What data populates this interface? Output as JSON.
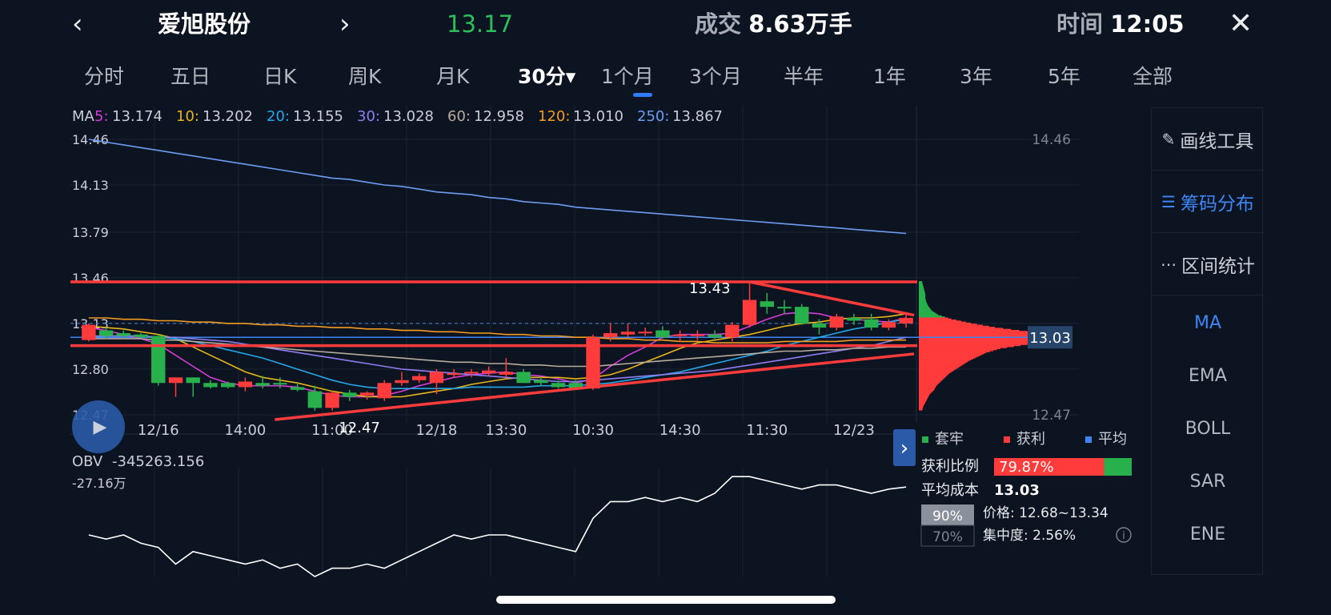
{
  "header": {
    "prev_icon": "chevron-left-icon",
    "next_icon": "chevron-right-icon",
    "close_icon": "close-icon",
    "prev_glyph": "‹",
    "next_glyph": "›",
    "close_glyph": "✕",
    "stock_name": "爱旭股份",
    "price": "13.17",
    "volume_label": "成交",
    "volume_value": "8.63万手",
    "time_label": "时间",
    "time_value": "12:05"
  },
  "tabs": [
    "分时",
    "五日",
    "日K",
    "周K",
    "月K",
    "30分▾",
    "1个月",
    "3个月",
    "半年",
    "1年",
    "3年",
    "5年",
    "全部"
  ],
  "active_tab": "30分",
  "colors": {
    "up": "#ff3b3b",
    "down": "#27b04b",
    "ma5": "#d63cd8",
    "ma10": "#e5b51a",
    "ma20": "#22a8e8",
    "ma30": "#8f7cf0",
    "ma60": "#b8aa9c",
    "ma120": "#f39a20",
    "ma250": "#6c9cf2",
    "accent": "#3e86f5",
    "trendline": "#ff3b3b",
    "obv": "#ffffff"
  },
  "ma_legend": {
    "label": "MA",
    "items": [
      {
        "key": "5:",
        "value": "13.174",
        "color": "#d63cd8"
      },
      {
        "key": "10:",
        "value": "13.202",
        "color": "#e5b51a"
      },
      {
        "key": "20:",
        "value": "13.155",
        "color": "#22a8e8"
      },
      {
        "key": "30:",
        "value": "13.028",
        "color": "#8f7cf0"
      },
      {
        "key": "60:",
        "value": "12.958",
        "color": "#b8aa9c"
      },
      {
        "key": "120:",
        "value": "13.010",
        "color": "#f39a20"
      },
      {
        "key": "250:",
        "value": "13.867",
        "color": "#6c9cf2"
      }
    ]
  },
  "chart_data": {
    "type": "candlestick",
    "ylim": [
      12.47,
      14.46
    ],
    "y_ticks_left": [
      "14.46",
      "14.13",
      "13.79",
      "13.46",
      "13.13",
      "12.80",
      "12.47"
    ],
    "y_ticks_right": [
      "14.46",
      "12.47"
    ],
    "x_tick_labels": [
      "12/16",
      "14:00",
      "11:00",
      "12/18",
      "13:30",
      "10:30",
      "14:30",
      "11:30",
      "12/23"
    ],
    "x_tick_index": [
      4,
      9,
      14,
      20,
      24,
      29,
      34,
      39,
      44
    ],
    "candles": [
      {
        "o": 13.01,
        "h": 13.13,
        "l": 13.0,
        "c": 13.12
      },
      {
        "o": 13.08,
        "h": 13.1,
        "l": 13.02,
        "c": 13.04
      },
      {
        "o": 13.06,
        "h": 13.08,
        "l": 13.02,
        "c": 13.04
      },
      {
        "o": 13.05,
        "h": 13.06,
        "l": 13.03,
        "c": 13.03
      },
      {
        "o": 13.04,
        "h": 13.05,
        "l": 12.68,
        "c": 12.7
      },
      {
        "o": 12.7,
        "h": 12.74,
        "l": 12.6,
        "c": 12.74
      },
      {
        "o": 12.74,
        "h": 12.74,
        "l": 12.6,
        "c": 12.7
      },
      {
        "o": 12.7,
        "h": 12.72,
        "l": 12.66,
        "c": 12.67
      },
      {
        "o": 12.7,
        "h": 12.71,
        "l": 12.66,
        "c": 12.67
      },
      {
        "o": 12.67,
        "h": 12.74,
        "l": 12.64,
        "c": 12.71
      },
      {
        "o": 12.7,
        "h": 12.75,
        "l": 12.66,
        "c": 12.68
      },
      {
        "o": 12.7,
        "h": 12.74,
        "l": 12.66,
        "c": 12.69
      },
      {
        "o": 12.67,
        "h": 12.7,
        "l": 12.64,
        "c": 12.65
      },
      {
        "o": 12.64,
        "h": 12.68,
        "l": 12.5,
        "c": 12.52
      },
      {
        "o": 12.52,
        "h": 12.64,
        "l": 12.5,
        "c": 12.63
      },
      {
        "o": 12.63,
        "h": 12.65,
        "l": 12.57,
        "c": 12.6
      },
      {
        "o": 12.61,
        "h": 12.64,
        "l": 12.58,
        "c": 12.63
      },
      {
        "o": 12.59,
        "h": 12.72,
        "l": 12.57,
        "c": 12.7
      },
      {
        "o": 12.7,
        "h": 12.78,
        "l": 12.68,
        "c": 12.72
      },
      {
        "o": 12.72,
        "h": 12.77,
        "l": 12.7,
        "c": 12.75
      },
      {
        "o": 12.7,
        "h": 12.8,
        "l": 12.62,
        "c": 12.78
      },
      {
        "o": 12.76,
        "h": 12.8,
        "l": 12.74,
        "c": 12.77
      },
      {
        "o": 12.77,
        "h": 12.8,
        "l": 12.74,
        "c": 12.78
      },
      {
        "o": 12.77,
        "h": 12.82,
        "l": 12.75,
        "c": 12.79
      },
      {
        "o": 12.76,
        "h": 12.88,
        "l": 12.74,
        "c": 12.78
      },
      {
        "o": 12.78,
        "h": 12.8,
        "l": 12.7,
        "c": 12.7
      },
      {
        "o": 12.72,
        "h": 12.74,
        "l": 12.68,
        "c": 12.7
      },
      {
        "o": 12.7,
        "h": 12.72,
        "l": 12.66,
        "c": 12.67
      },
      {
        "o": 12.7,
        "h": 12.72,
        "l": 12.65,
        "c": 12.66
      },
      {
        "o": 12.66,
        "h": 13.05,
        "l": 12.65,
        "c": 13.03
      },
      {
        "o": 13.03,
        "h": 13.13,
        "l": 13.0,
        "c": 13.06
      },
      {
        "o": 13.05,
        "h": 13.13,
        "l": 13.03,
        "c": 13.07
      },
      {
        "o": 13.06,
        "h": 13.1,
        "l": 13.04,
        "c": 13.07
      },
      {
        "o": 13.08,
        "h": 13.11,
        "l": 13.02,
        "c": 13.03
      },
      {
        "o": 13.04,
        "h": 13.08,
        "l": 13.0,
        "c": 13.05
      },
      {
        "o": 13.04,
        "h": 13.08,
        "l": 13.01,
        "c": 13.05
      },
      {
        "o": 13.05,
        "h": 13.08,
        "l": 13.01,
        "c": 13.03
      },
      {
        "o": 13.03,
        "h": 13.14,
        "l": 13.0,
        "c": 13.12
      },
      {
        "o": 13.12,
        "h": 13.43,
        "l": 13.1,
        "c": 13.3
      },
      {
        "o": 13.29,
        "h": 13.35,
        "l": 13.2,
        "c": 13.25
      },
      {
        "o": 13.25,
        "h": 13.3,
        "l": 13.2,
        "c": 13.24
      },
      {
        "o": 13.25,
        "h": 13.27,
        "l": 13.12,
        "c": 13.13
      },
      {
        "o": 13.13,
        "h": 13.16,
        "l": 13.05,
        "c": 13.1
      },
      {
        "o": 13.1,
        "h": 13.2,
        "l": 13.08,
        "c": 13.18
      },
      {
        "o": 13.17,
        "h": 13.2,
        "l": 13.12,
        "c": 13.15
      },
      {
        "o": 13.16,
        "h": 13.2,
        "l": 13.08,
        "c": 13.1
      },
      {
        "o": 13.1,
        "h": 13.16,
        "l": 13.08,
        "c": 13.14
      },
      {
        "o": 13.13,
        "h": 13.2,
        "l": 13.1,
        "c": 13.17
      }
    ],
    "ma_series": {
      "ma5": [
        13.1,
        13.08,
        13.05,
        13.02,
        12.98,
        12.9,
        12.82,
        12.74,
        12.7,
        12.68,
        12.68,
        12.68,
        12.67,
        12.64,
        12.61,
        12.6,
        12.6,
        12.61,
        12.64,
        12.68,
        12.71,
        12.74,
        12.76,
        12.77,
        12.78,
        12.76,
        12.75,
        12.73,
        12.7,
        12.73,
        12.82,
        12.9,
        12.96,
        13.03,
        13.05,
        13.05,
        13.05,
        13.06,
        13.11,
        13.16,
        13.2,
        13.21,
        13.2,
        13.17,
        13.16,
        13.15,
        13.14,
        13.17
      ],
      "ma10": [
        13.11,
        13.1,
        13.09,
        13.07,
        13.05,
        13.02,
        12.96,
        12.9,
        12.84,
        12.78,
        12.74,
        12.72,
        12.7,
        12.67,
        12.64,
        12.62,
        12.6,
        12.6,
        12.6,
        12.62,
        12.64,
        12.66,
        12.69,
        12.71,
        12.73,
        12.74,
        12.74,
        12.74,
        12.73,
        12.74,
        12.76,
        12.8,
        12.85,
        12.9,
        12.95,
        12.99,
        13.01,
        13.03,
        13.05,
        13.08,
        13.11,
        13.13,
        13.14,
        13.16,
        13.17,
        13.17,
        13.18,
        13.2
      ],
      "ma20": [
        13.03,
        13.04,
        13.04,
        13.04,
        13.03,
        13.02,
        13.0,
        12.97,
        12.94,
        12.91,
        12.88,
        12.84,
        12.8,
        12.76,
        12.72,
        12.69,
        12.67,
        12.66,
        12.66,
        12.66,
        12.66,
        12.66,
        12.67,
        12.67,
        12.67,
        12.67,
        12.68,
        12.68,
        12.68,
        12.69,
        12.7,
        12.72,
        12.74,
        12.76,
        12.78,
        12.81,
        12.84,
        12.87,
        12.9,
        12.93,
        12.97,
        13.0,
        13.03,
        13.06,
        13.09,
        13.11,
        13.14,
        13.16
      ],
      "ma30": [
        13.04,
        13.04,
        13.04,
        13.04,
        13.03,
        13.03,
        13.02,
        13.01,
        13.0,
        12.98,
        12.96,
        12.94,
        12.92,
        12.9,
        12.88,
        12.86,
        12.84,
        12.82,
        12.8,
        12.79,
        12.78,
        12.77,
        12.76,
        12.75,
        12.74,
        12.73,
        12.72,
        12.71,
        12.71,
        12.72,
        12.73,
        12.74,
        12.75,
        12.76,
        12.77,
        12.78,
        12.79,
        12.81,
        12.83,
        12.85,
        12.87,
        12.89,
        12.91,
        12.93,
        12.95,
        12.97,
        13.0,
        13.03
      ],
      "ma60": [
        13.02,
        13.02,
        13.02,
        13.02,
        13.01,
        13.01,
        13.0,
        12.99,
        12.98,
        12.97,
        12.96,
        12.95,
        12.94,
        12.93,
        12.92,
        12.91,
        12.9,
        12.89,
        12.88,
        12.87,
        12.86,
        12.85,
        12.85,
        12.84,
        12.84,
        12.83,
        12.83,
        12.82,
        12.82,
        12.82,
        12.83,
        12.84,
        12.85,
        12.86,
        12.87,
        12.88,
        12.89,
        12.9,
        12.91,
        12.92,
        12.93,
        12.93,
        12.94,
        12.94,
        12.95,
        12.95,
        12.96,
        12.96
      ],
      "ma120": [
        13.17,
        13.17,
        13.16,
        13.16,
        13.15,
        13.15,
        13.14,
        13.14,
        13.13,
        13.13,
        13.12,
        13.12,
        13.11,
        13.11,
        13.1,
        13.1,
        13.09,
        13.09,
        13.08,
        13.08,
        13.07,
        13.07,
        13.06,
        13.06,
        13.05,
        13.05,
        13.04,
        13.04,
        13.03,
        13.03,
        13.02,
        13.02,
        13.01,
        13.01,
        13.0,
        13.0,
        12.99,
        12.99,
        12.99,
        12.99,
        13.0,
        13.0,
        13.0,
        13.0,
        13.01,
        13.01,
        13.01,
        13.01
      ],
      "ma250": [
        14.46,
        14.44,
        14.42,
        14.4,
        14.38,
        14.36,
        14.34,
        14.32,
        14.3,
        14.28,
        14.26,
        14.24,
        14.22,
        14.2,
        14.18,
        14.17,
        14.15,
        14.13,
        14.12,
        14.1,
        14.08,
        14.07,
        14.06,
        14.04,
        14.03,
        14.01,
        14.0,
        13.99,
        13.97,
        13.96,
        13.95,
        13.94,
        13.93,
        13.92,
        13.91,
        13.9,
        13.89,
        13.88,
        13.87,
        13.86,
        13.85,
        13.84,
        13.83,
        13.82,
        13.81,
        13.8,
        13.79,
        13.78
      ]
    },
    "annotations": {
      "high_label": "13.43",
      "low_label": "12.47",
      "high_value": 13.43,
      "low_value": 12.47,
      "high_index": 38,
      "low_index": 13,
      "resistance": 13.43,
      "support": 12.97,
      "wedge_top": {
        "from": [
          38,
          13.43
        ],
        "to": [
          47,
          13.19
        ]
      },
      "wedge_bottom": {
        "from": [
          13,
          12.47
        ],
        "to": [
          47,
          12.91
        ]
      },
      "avg_cost_line": 13.03,
      "dashed_price": 13.13
    },
    "obv": {
      "label": "OBV",
      "value": "-345263.156",
      "axis_label": "-27.16万",
      "series": [
        -30,
        -31,
        -30,
        -32,
        -33,
        -37,
        -34,
        -35,
        -36,
        -37,
        -36,
        -38,
        -37,
        -40,
        -38,
        -38,
        -37,
        -38,
        -36,
        -34,
        -32,
        -30,
        -31,
        -30,
        -30,
        -31,
        -32,
        -33,
        -34,
        -26,
        -22,
        -22,
        -21,
        -22,
        -21,
        -22,
        -20,
        -16,
        -16,
        -17,
        -18,
        -19,
        -18,
        -18,
        -19,
        -20,
        -19,
        -18.5
      ]
    },
    "chip_distribution": {
      "price_levels": [
        13.43,
        13.4,
        13.37,
        13.34,
        13.31,
        13.28,
        13.25,
        13.22,
        13.19,
        13.16,
        13.13,
        13.1,
        13.07,
        13.04,
        13.01,
        12.98,
        12.95,
        12.92,
        12.89,
        12.86,
        12.83,
        12.8,
        12.77,
        12.74,
        12.71,
        12.68,
        12.65,
        12.62,
        12.59,
        12.56,
        12.53,
        12.5
      ],
      "volumes": [
        3,
        4,
        5,
        6,
        6,
        7,
        9,
        12,
        18,
        30,
        48,
        70,
        100,
        122,
        140,
        100,
        75,
        62,
        54,
        46,
        40,
        34,
        28,
        24,
        20,
        16,
        14,
        10,
        8,
        6,
        4,
        3
      ],
      "profit_threshold": 13.17
    }
  },
  "chip_panel": {
    "legend_trapped": "套牢",
    "legend_profit": "获利",
    "legend_average": "平均",
    "profit_ratio_label": "获利比例",
    "profit_ratio_value": "79.87%",
    "profit_ratio_fraction": 0.7987,
    "avg_cost_label": "平均成本",
    "avg_cost_value": "13.03",
    "avg_cost_tag": "13.03",
    "btn_90": "90%",
    "btn_70": "70%",
    "price_range": "价格: 12.68~13.34",
    "concentration": "集中度: 2.56%",
    "info_icon": "info-icon",
    "expand_icon": "chevron-right-icon",
    "expand_glyph": "›"
  },
  "sidebar": {
    "tools": [
      {
        "label": "画线工具",
        "icon": "pen-icon",
        "glyph": "✎",
        "active": false
      },
      {
        "label": "筹码分布",
        "icon": "list-icon",
        "glyph": "☰",
        "active": true
      },
      {
        "label": "区间统计",
        "icon": "range-stat-icon",
        "glyph": "⋯",
        "active": false
      }
    ],
    "indicators": [
      {
        "label": "MA",
        "active": true
      },
      {
        "label": "EMA",
        "active": false
      },
      {
        "label": "BOLL",
        "active": false
      },
      {
        "label": "SAR",
        "active": false
      },
      {
        "label": "ENE",
        "active": false
      }
    ]
  },
  "play_icon": "play-icon",
  "play_glyph": "▶"
}
